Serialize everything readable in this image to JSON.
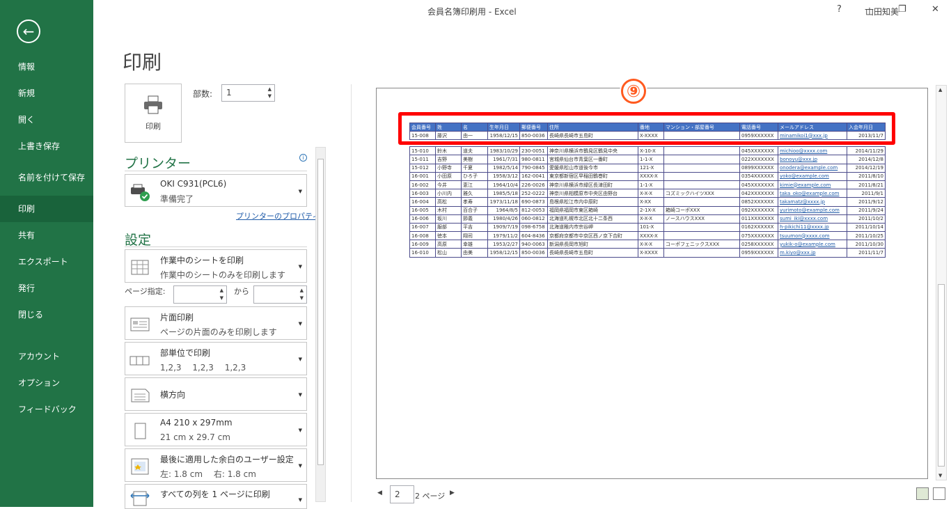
{
  "window": {
    "title": "会員名簿印刷用 - Excel",
    "user": "山田知美",
    "help": "?",
    "minimize": "—",
    "restore": "❐",
    "close": "✕"
  },
  "sidebar": {
    "items": [
      "情報",
      "新規",
      "開く",
      "上書き保存",
      "名前を付けて保存",
      "印刷",
      "共有",
      "エクスポート",
      "発行",
      "閉じる",
      "アカウント",
      "オプション",
      "フィードバック"
    ],
    "active": "印刷"
  },
  "page": {
    "title": "印刷"
  },
  "print": {
    "button_label": "印刷",
    "copies_label": "部数:",
    "copies_value": "1"
  },
  "printer": {
    "heading": "プリンター",
    "name": "OKI C931(PCL6)",
    "status": "準備完了",
    "properties_link": "プリンターのプロパティ"
  },
  "settings": {
    "heading": "設定",
    "scope": {
      "title": "作業中のシートを印刷",
      "desc": "作業中のシートのみを印刷します"
    },
    "pages_label": "ページ指定:",
    "to_label": "から",
    "sides": {
      "title": "片面印刷",
      "desc": "ページの片面のみを印刷します"
    },
    "collate": {
      "title": "部単位で印刷",
      "desc": "1,2,3　 1,2,3　 1,2,3"
    },
    "orientation": {
      "title": "横方向"
    },
    "paper": {
      "title": "A4 210 x 297mm",
      "desc": "21 cm x 29.7 cm"
    },
    "margins": {
      "title": "最後に適用した余白のユーザー設定",
      "desc": "左:  1.8 cm　 右:  1.8 cm"
    },
    "scaling": {
      "title": "すべての列を 1 ページに印刷"
    }
  },
  "preview": {
    "badge": "⑨",
    "current_page": "2",
    "total_pages": "2 ページ",
    "table": {
      "headers": [
        "会員番号",
        "姓",
        "名",
        "生年月日",
        "郵便番号",
        "住所",
        "番地",
        "マンション・部屋番号",
        "電話番号",
        "メールアドレス",
        "入会年月日"
      ],
      "rows": [
        [
          "15-008",
          "藤沢",
          "由一",
          "1958/12/15",
          "850-0036",
          "長崎県長崎市五島町",
          "X-XXXX",
          "",
          "0959XXXXXX",
          "minamikoi1@xxx.jp",
          "2013/11/7"
        ],
        [
          "15-010",
          "鈴木",
          "道夫",
          "1983/10/29",
          "230-0051",
          "神奈川県横浜市鶴見区鶴見中央",
          "X-10-X",
          "",
          "045XXXXXXX",
          "michioo@xxxx.com",
          "2014/11/29"
        ],
        [
          "15-011",
          "吉野",
          "美樹",
          "1961/7/31",
          "980-0811",
          "宮城県仙台市青葉区一番町",
          "1-1-X",
          "",
          "022XXXXXXX",
          "bonoyu@xxx.jp",
          "2014/12/8"
        ],
        [
          "15-012",
          "小野寺",
          "千夏",
          "1982/5/14",
          "790-0845",
          "愛媛県松山市道後今市",
          "121-X",
          "",
          "0899XXXXXX",
          "onodera@example.com",
          "2014/12/19"
        ],
        [
          "16-001",
          "小田原",
          "ひろ子",
          "1958/3/12",
          "162-0041",
          "東京都新宿区早稲田鶴巻町",
          "XXXX-X",
          "",
          "0354XXXXXX",
          "yoko@example.com",
          "2011/8/10"
        ],
        [
          "16-002",
          "今井",
          "恵江",
          "1964/10/4",
          "226-0026",
          "神奈川県横浜市緑区長津田町",
          "1-1-X",
          "",
          "045XXXXXXX",
          "kimie@example.com",
          "2011/8/21"
        ],
        [
          "16-003",
          "小川内",
          "雅久",
          "1985/5/18",
          "252-0222",
          "神奈川県相模原市中央区由野台",
          "X-X-X",
          "コズミックハイツXXX",
          "042XXXXXXX",
          "taka_oko@example.com",
          "2011/9/1"
        ],
        [
          "16-004",
          "高松",
          "孝寿",
          "1973/11/18",
          "690-0873",
          "島根県松江市内中原町",
          "X-XX",
          "",
          "0852XXXXXX",
          "takamatz@xxxx.jp",
          "2011/9/12"
        ],
        [
          "16-005",
          "木村",
          "百合子",
          "1964/8/5",
          "812-0053",
          "福岡県福岡市東区箱崎",
          "2-1X-X",
          "箱崎コーポXXX",
          "092XXXXXXX",
          "yurimoto@example.com",
          "2011/9/24"
        ],
        [
          "16-006",
          "坂川",
          "節義",
          "1980/4/26",
          "060-0812",
          "北海道札幌市北区北十二条西",
          "X-X-X",
          "ノースハウスXXX",
          "011XXXXXXX",
          "sumi_iki@xxxx.com",
          "2011/10/2"
        ],
        [
          "16-007",
          "服部",
          "平吉",
          "1909/7/19",
          "098-6758",
          "北海道稚内市宗谷岬",
          "101-X",
          "",
          "0162XXXXXX",
          "h-pikichi11@xxxx.jp",
          "2011/10/14"
        ],
        [
          "16-008",
          "徳本",
          "翔司",
          "1979/11/2",
          "604-8436",
          "京都府京都市中京区西ノ京下合町",
          "XXXX-X",
          "",
          "075XXXXXXX",
          "tsuumon@xxxx.com",
          "2011/10/25"
        ],
        [
          "16-009",
          "高原",
          "幸雄",
          "1953/2/27",
          "940-0063",
          "新潟県長岡市旭町",
          "X-X-X",
          "コーポフェニックスXXX",
          "0258XXXXXX",
          "yukik-o@example.com",
          "2011/10/30"
        ],
        [
          "16-010",
          "松山",
          "由美",
          "1958/12/15",
          "850-0036",
          "長崎県長崎市五島町",
          "X-XXXX",
          "",
          "0959XXXXXX",
          "m.kiyo@xxx.jp",
          "2011/11/7"
        ]
      ]
    }
  }
}
